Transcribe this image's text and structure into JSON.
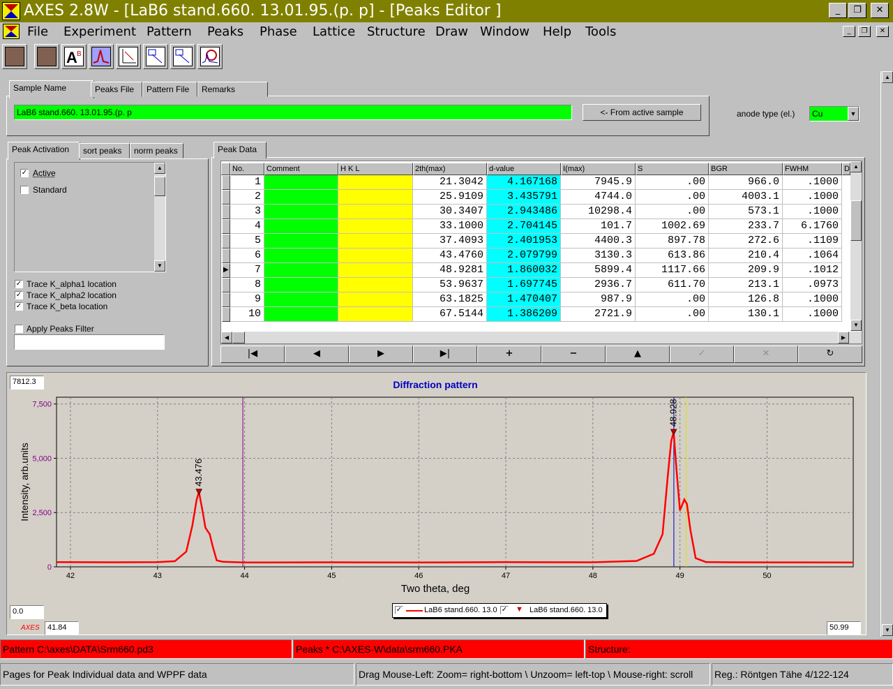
{
  "window": {
    "title": "AXES 2.8W - [LaB6 stand.660. 13.01.95.(p. p] - [Peaks Editor ]",
    "minimize": "_",
    "restore": "❐",
    "close": "✕"
  },
  "menu": [
    "File",
    "Experiment",
    "Pattern",
    "Peaks",
    "Phase",
    "Lattice",
    "Structure",
    "Draw",
    "Window",
    "Help",
    "Tools"
  ],
  "toolbar": {
    "icons": [
      "blank-tool-icon",
      "blank-tool-icon",
      "font-icon",
      "peak-pick-icon",
      "axes-icon",
      "zoom-icon",
      "zoom-icon",
      "zoom-icon",
      "search-peak-icon"
    ]
  },
  "sample": {
    "tabs": [
      "Sample Name",
      "Peaks File",
      "Pattern File",
      "Remarks"
    ],
    "name": "LaB6 stand.660. 13.01.95.(p. p",
    "from_active_button": "<- From active sample",
    "anode_label": "anode type (el.)",
    "anode_value": "Cu"
  },
  "activation": {
    "tabs": [
      "Peak Activation",
      "sort peaks",
      "norm peaks"
    ],
    "list": [
      {
        "label": "Active",
        "checked": true
      },
      {
        "label": "Standard",
        "checked": false
      }
    ],
    "traces": [
      {
        "label": "Trace K_alpha1 location",
        "checked": true
      },
      {
        "label": "Trace K_alpha2 location",
        "checked": true
      },
      {
        "label": "Trace K_beta location",
        "checked": true
      }
    ],
    "filter_label": "Apply Peaks Filter",
    "filter_checked": false,
    "filter_value": ""
  },
  "peak_data": {
    "tab": "Peak Data",
    "columns": [
      "No.",
      "Comment",
      "H K L",
      "2th(max)",
      "d-value",
      "I(max)",
      "S",
      "BGR",
      "FWHM",
      "D"
    ],
    "rows": [
      [
        "1",
        "",
        "",
        "21.3042",
        "4.167168",
        "7945.9",
        ".00",
        "966.0",
        ".1000"
      ],
      [
        "2",
        "",
        "",
        "25.9109",
        "3.435791",
        "4744.0",
        ".00",
        "4003.1",
        ".1000"
      ],
      [
        "3",
        "",
        "",
        "30.3407",
        "2.943486",
        "10298.4",
        ".00",
        "573.1",
        ".1000"
      ],
      [
        "4",
        "",
        "",
        "33.1000",
        "2.704145",
        "101.7",
        "1002.69",
        "233.7",
        "6.1760"
      ],
      [
        "5",
        "",
        "",
        "37.4093",
        "2.401953",
        "4400.3",
        "897.78",
        "272.6",
        ".1109"
      ],
      [
        "6",
        "",
        "",
        "43.4760",
        "2.079799",
        "3130.3",
        "613.86",
        "210.4",
        ".1064"
      ],
      [
        "7",
        "",
        "",
        "48.9281",
        "1.860032",
        "5899.4",
        "1117.66",
        "209.9",
        ".1012"
      ],
      [
        "8",
        "",
        "",
        "53.9637",
        "1.697745",
        "2936.7",
        "611.70",
        "213.1",
        ".0973"
      ],
      [
        "9",
        "",
        "",
        "63.1825",
        "1.470407",
        "987.9",
        ".00",
        "126.8",
        ".1000"
      ],
      [
        "10",
        "",
        "",
        "67.5144",
        "1.386209",
        "2721.9",
        ".00",
        "130.1",
        ".1000"
      ]
    ],
    "current_row": 7,
    "nav": [
      "|◀",
      "◀",
      "▶",
      "▶|",
      "+",
      "−",
      "▲",
      "✓",
      "✕",
      "↻"
    ]
  },
  "colors": {
    "comment": "#00ff00",
    "hkl": "#ffff00",
    "dvalue": "#00ffff",
    "status_red": "#ff0000",
    "curve": "#ff0000"
  },
  "chart_data": {
    "type": "line",
    "title": "Diffraction pattern",
    "xlabel": "Two theta, deg",
    "ylabel": "Intensity, arb.units",
    "xlim": [
      41.84,
      50.99
    ],
    "ylim": [
      0,
      7812.3
    ],
    "x_ticks": [
      "42",
      "43",
      "44",
      "45",
      "46",
      "47",
      "48",
      "49",
      "50"
    ],
    "y_ticks": [
      "0",
      "2,500",
      "5,000",
      "7,500"
    ],
    "grid": true,
    "y_max_label": "7812.3",
    "y_min_label": "0.0",
    "x_min_label": "41.84",
    "x_max_label": "50.99",
    "watermark": "AXES",
    "annotations": [
      {
        "x": 43.476,
        "label": "43.476"
      },
      {
        "x": 48.928,
        "label": "48.928"
      }
    ],
    "markers": [
      {
        "x": 43.98,
        "color": "purple"
      },
      {
        "x": 48.93,
        "color": "blue"
      },
      {
        "x": 49.07,
        "color": "yellow"
      }
    ],
    "series": [
      {
        "name": "LaB6 stand.660. 13.0",
        "style": "line",
        "color": "#ff0000",
        "x": [
          41.84,
          42.5,
          43.0,
          43.2,
          43.33,
          43.4,
          43.45,
          43.476,
          43.52,
          43.55,
          43.6,
          43.63,
          43.68,
          43.75,
          44.0,
          45.0,
          46.0,
          47.0,
          48.0,
          48.5,
          48.7,
          48.8,
          48.86,
          48.9,
          48.928,
          48.96,
          49.0,
          49.05,
          49.08,
          49.12,
          49.18,
          49.3,
          49.6,
          50.0,
          50.99
        ],
        "y": [
          220,
          210,
          215,
          260,
          700,
          1900,
          3100,
          3450,
          2500,
          1800,
          1500,
          1000,
          300,
          230,
          200,
          210,
          200,
          215,
          210,
          270,
          600,
          1500,
          4200,
          5800,
          6200,
          4500,
          2600,
          3100,
          2900,
          1700,
          400,
          220,
          210,
          205,
          200
        ]
      },
      {
        "name": "LaB6 stand.660. 13.0",
        "style": "peaks",
        "color": "#ff0000",
        "x": [
          43.476,
          48.928
        ],
        "y": [
          3450,
          6200
        ]
      }
    ]
  },
  "statusbar": {
    "pattern": "Pattern  C:\\axes\\DATA\\Srm660.pd3",
    "peaks": "Peaks  *  C:\\AXES-W\\data\\srm660.PKA",
    "structure": "Structure:",
    "hint": "Pages for Peak Individual data and WPPF data",
    "mouse": "Drag Mouse-Left: Zoom= right-bottom \\ Unzoom= left-top \\ Mouse-right: scroll",
    "reg": "Reg.: Röntgen Tähe 4/122-124"
  }
}
